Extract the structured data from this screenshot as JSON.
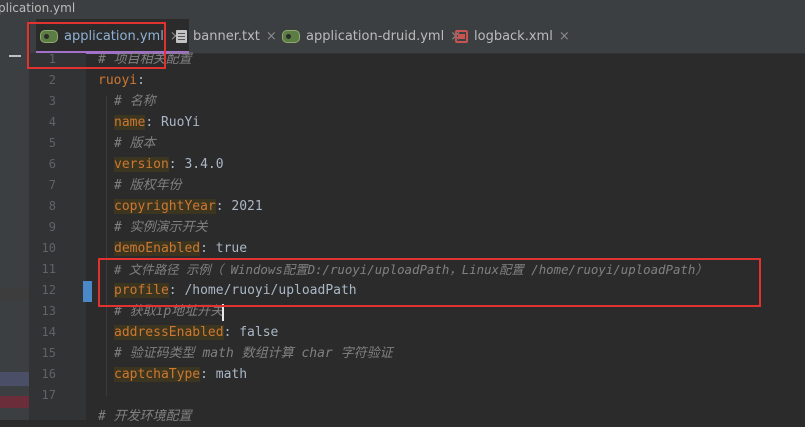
{
  "window": {
    "title": "plication.yml"
  },
  "tabs": [
    {
      "label": "application.yml",
      "icon": "yml-icon",
      "active": true
    },
    {
      "label": "banner.txt",
      "icon": "txt-icon",
      "active": false
    },
    {
      "label": "application-druid.yml",
      "icon": "yml-icon",
      "active": false
    },
    {
      "label": "logback.xml",
      "icon": "xml-icon",
      "active": false
    }
  ],
  "tab_close_glyph": "×",
  "editor": {
    "line_numbers": [
      "1",
      "2",
      "3",
      "4",
      "5",
      "6",
      "7",
      "8",
      "9",
      "10",
      "11",
      "12",
      "13",
      "14",
      "15",
      "16",
      "17"
    ],
    "lines": {
      "l1": "# 项目相关配置",
      "l2_key": "ruoyi",
      "l2_sep": ":",
      "l3": "# 名称",
      "l4_key": "name",
      "l4_val": ": RuoYi",
      "l5": "# 版本",
      "l6_key": "version",
      "l6_val": ": 3.4.0",
      "l7": "# 版权年份",
      "l8_key": "copyrightYear",
      "l8_val": ": 2021",
      "l9": "# 实例演示开关",
      "l10_key": "demoEnabled",
      "l10_val": ": true",
      "l11": "# 文件路径 示例（ Windows配置D:/ruoyi/uploadPath，Linux配置 /home/ruoyi/uploadPath）",
      "l12_key": "profile",
      "l12_val": ": /home/ruoyi/uploadPath",
      "l13": "# 获取ip地址开关",
      "l14_key": "addressEnabled",
      "l14_val": ": false",
      "l15": "# 验证码类型 math 数组计算 char 字符验证",
      "l16_key": "captchaType",
      "l16_val": ": math",
      "l18": "# 开发环境配置"
    }
  },
  "colors": {
    "background": "#2b2b2b",
    "comment": "#808080",
    "key": "#cc7832",
    "annotation": "#e0332f",
    "active_tab_underline": "#a371c9"
  }
}
